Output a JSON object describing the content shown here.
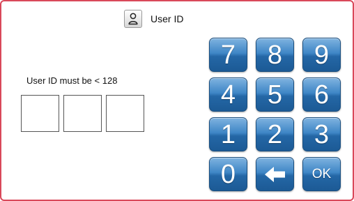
{
  "header": {
    "icon": "user-icon",
    "title": "User ID"
  },
  "form": {
    "hint": "User ID must be < 128",
    "digits": [
      "",
      "",
      ""
    ]
  },
  "keypad": {
    "keys": [
      {
        "label": "7"
      },
      {
        "label": "8"
      },
      {
        "label": "9"
      },
      {
        "label": "4"
      },
      {
        "label": "5"
      },
      {
        "label": "6"
      },
      {
        "label": "1"
      },
      {
        "label": "2"
      },
      {
        "label": "3"
      },
      {
        "label": "0"
      },
      {
        "label": "",
        "icon": "backspace-arrow-icon"
      },
      {
        "label": "OK"
      }
    ]
  },
  "colors": {
    "border": "#d9485a",
    "key_blue": "#2467a6",
    "key_text": "#ffffff"
  }
}
